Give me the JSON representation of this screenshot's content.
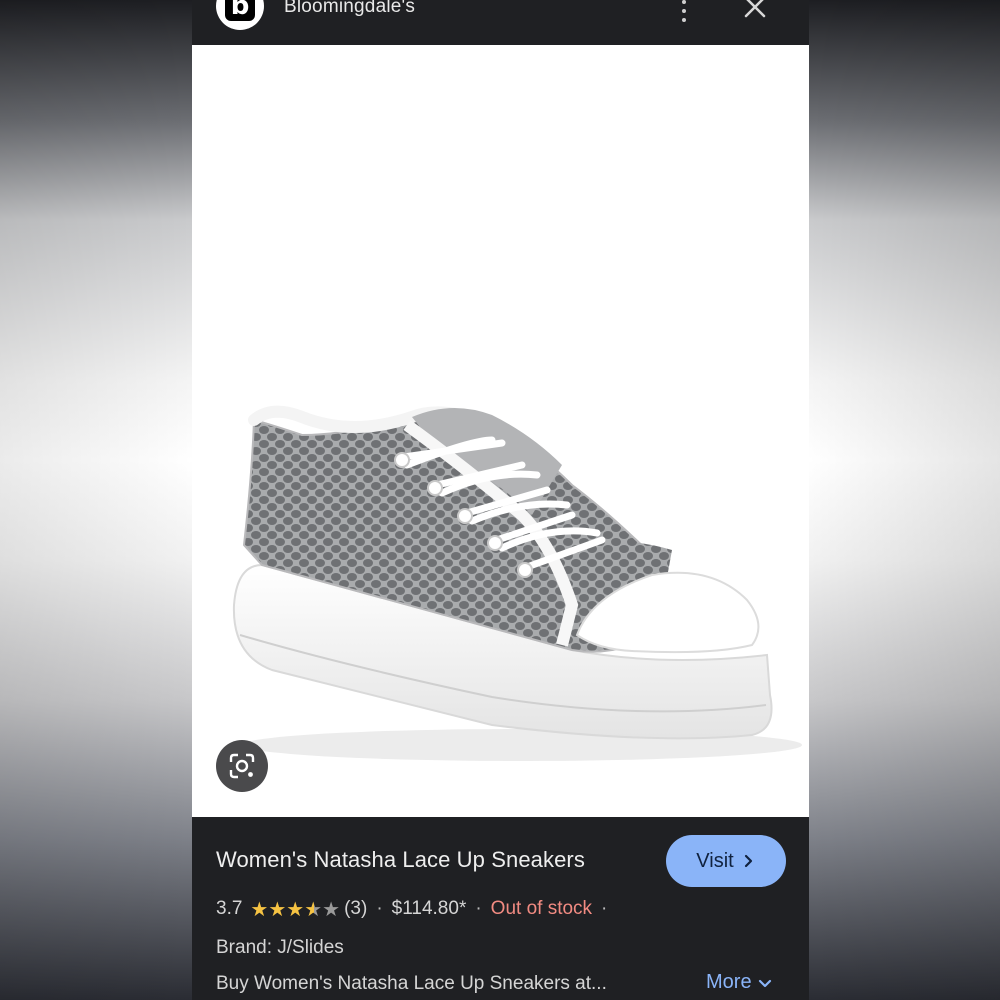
{
  "header": {
    "site_name": "Bloomingdale's",
    "logo_letter": "b"
  },
  "product": {
    "title": "Women's Natasha Lace Up Sneakers",
    "rating": "3.7",
    "rating_value": 3.7,
    "review_count": "(3)",
    "price": "$114.80*",
    "stock_status": "Out of stock",
    "separator": "·",
    "brand": "Brand: J/Slides",
    "description": "Buy Women's Natasha Lace Up Sneakers at..."
  },
  "actions": {
    "visit_label": "Visit",
    "more_label": "More"
  },
  "icons": {
    "more": "more-vert-icon",
    "close": "close-icon",
    "lens": "google-lens-icon",
    "chevron_right": "chevron-right-icon",
    "chevron_down": "chevron-down-icon"
  },
  "colors": {
    "panel_bg": "#1f2023",
    "accent_blue": "#8ab4f8",
    "star_yellow": "#f6c343",
    "stock_red": "#f28b82"
  }
}
